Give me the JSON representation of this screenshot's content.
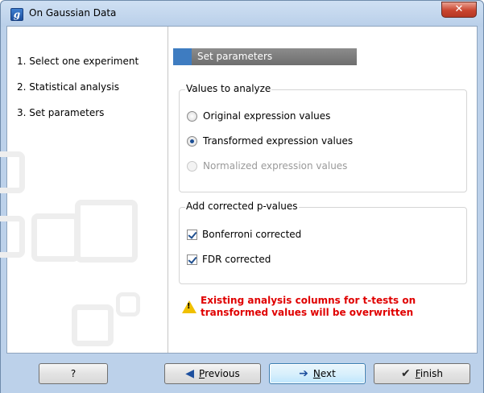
{
  "window": {
    "title": "On Gaussian Data",
    "app_icon": "clc-app-icon",
    "close_glyph": "✕"
  },
  "steps": [
    {
      "label": "1.  Select one experiment"
    },
    {
      "label": "2.  Statistical analysis"
    },
    {
      "label": "3.  Set parameters"
    }
  ],
  "banner": {
    "title": "Set parameters",
    "accent_color": "#3e7cc1"
  },
  "values_group": {
    "label": "Values to analyze",
    "options": [
      {
        "label": "Original expression values",
        "checked": false,
        "enabled": true
      },
      {
        "label": "Transformed expression values",
        "checked": true,
        "enabled": true
      },
      {
        "label": "Normalized expression values",
        "checked": false,
        "enabled": false
      }
    ]
  },
  "pvalues_group": {
    "label": "Add corrected p-values",
    "options": [
      {
        "label": "Bonferroni corrected",
        "checked": true
      },
      {
        "label": "FDR corrected",
        "checked": true
      }
    ]
  },
  "warning": {
    "line1": "Existing analysis columns for t-tests on",
    "line2": "transformed values will be overwritten",
    "color": "#e00000"
  },
  "buttons": {
    "help": "?",
    "previous_first": "P",
    "previous_rest": "revious",
    "next_first": "N",
    "next_rest": "ext",
    "finish_first": "F",
    "finish_rest": "inish"
  }
}
